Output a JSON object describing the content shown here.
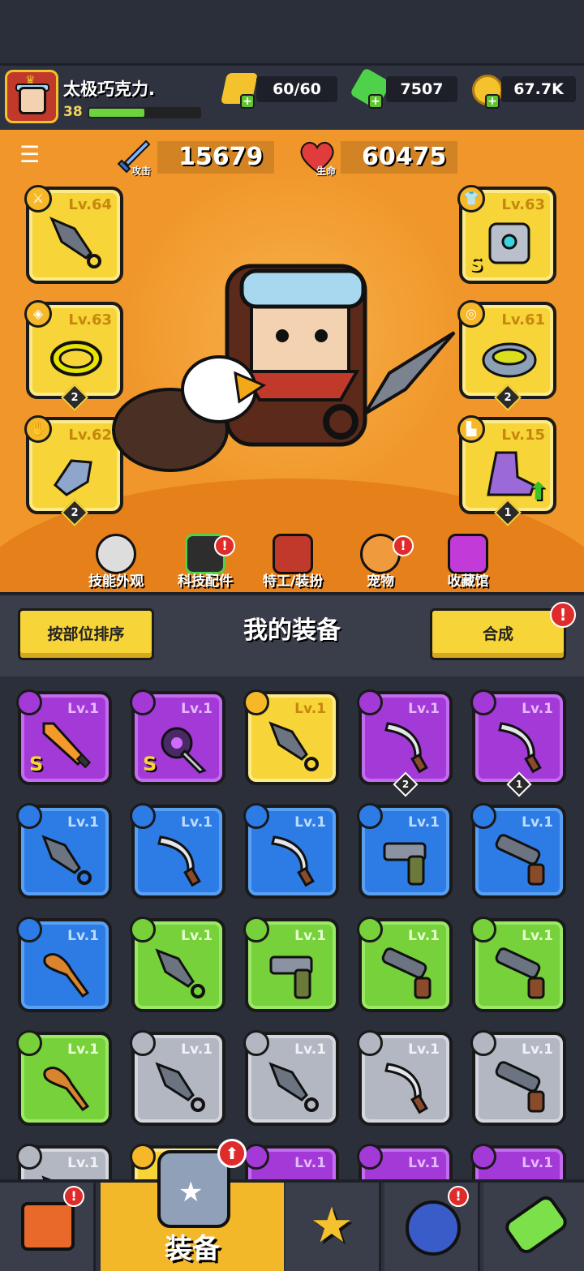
{
  "player": {
    "name": "太极巧克力.",
    "level": "38",
    "xp_fraction": 0.5
  },
  "resources": {
    "energy": "60/60",
    "gems": "7507",
    "coins": "67.7K"
  },
  "stats": {
    "attack_value": "15679",
    "attack_label": "攻击",
    "hp_value": "60475",
    "hp_label": "生命"
  },
  "equipped": {
    "weapon": {
      "level": "Lv.64"
    },
    "necklace": {
      "level": "Lv.63",
      "count": "2"
    },
    "gloves": {
      "level": "Lv.62",
      "count": "2"
    },
    "armor": {
      "level": "Lv.63",
      "grade": "S"
    },
    "belt": {
      "level": "Lv.61",
      "count": "2"
    },
    "boots": {
      "level": "Lv.15",
      "count": "1"
    }
  },
  "tabs": [
    "技能外观",
    "科技配件",
    "特工/装扮",
    "宠物",
    "收藏馆"
  ],
  "inventory": {
    "sort_button": "按部位排序",
    "title": "我的装备",
    "merge_button": "合成",
    "badge": "!",
    "items": [
      {
        "lv": "Lv.1",
        "color": "purple",
        "s": "S",
        "icon": "flame-sword-icon"
      },
      {
        "lv": "Lv.1",
        "color": "purple",
        "s": "S",
        "icon": "dark-blade-icon"
      },
      {
        "lv": "Lv.1",
        "color": "yellow",
        "s": "",
        "icon": "kunai-icon"
      },
      {
        "lv": "Lv.1",
        "color": "purple",
        "s": "",
        "icon": "scimitar-icon",
        "count": "2"
      },
      {
        "lv": "Lv.1",
        "color": "purple",
        "s": "",
        "icon": "scimitar-icon",
        "count": "1"
      },
      {
        "lv": "Lv.1",
        "color": "blue",
        "s": "",
        "icon": "kunai-icon"
      },
      {
        "lv": "Lv.1",
        "color": "blue",
        "s": "",
        "icon": "scimitar-icon"
      },
      {
        "lv": "Lv.1",
        "color": "blue",
        "s": "",
        "icon": "scimitar-icon"
      },
      {
        "lv": "Lv.1",
        "color": "blue",
        "s": "",
        "icon": "revolver-icon"
      },
      {
        "lv": "Lv.1",
        "color": "blue",
        "s": "",
        "icon": "shotgun-icon"
      },
      {
        "lv": "Lv.1",
        "color": "blue",
        "s": "",
        "icon": "bat-icon"
      },
      {
        "lv": "Lv.1",
        "color": "green",
        "s": "",
        "icon": "kunai-icon"
      },
      {
        "lv": "Lv.1",
        "color": "green",
        "s": "",
        "icon": "revolver-icon"
      },
      {
        "lv": "Lv.1",
        "color": "green",
        "s": "",
        "icon": "shotgun-icon"
      },
      {
        "lv": "Lv.1",
        "color": "green",
        "s": "",
        "icon": "shotgun-icon"
      },
      {
        "lv": "Lv.1",
        "color": "green",
        "s": "",
        "icon": "bat-icon"
      },
      {
        "lv": "Lv.1",
        "color": "grey",
        "s": "",
        "icon": "kunai-icon"
      },
      {
        "lv": "Lv.1",
        "color": "grey",
        "s": "",
        "icon": "kunai-icon"
      },
      {
        "lv": "Lv.1",
        "color": "grey",
        "s": "",
        "icon": "scimitar-icon"
      },
      {
        "lv": "Lv.1",
        "color": "grey",
        "s": "",
        "icon": "shotgun-icon"
      },
      {
        "lv": "Lv.1",
        "color": "grey",
        "s": "",
        "icon": "kunai-icon"
      },
      {
        "lv": "Lv.1",
        "color": "yellow",
        "s": "",
        "icon": "necklace-icon"
      },
      {
        "lv": "Lv.1",
        "color": "purple",
        "s": "",
        "icon": "armor-icon"
      },
      {
        "lv": "Lv.1",
        "color": "purple",
        "s": "",
        "icon": "armor-icon"
      },
      {
        "lv": "Lv.1",
        "color": "purple",
        "s": "",
        "icon": "armor-icon"
      }
    ]
  },
  "nav": {
    "active_label": "装备"
  }
}
